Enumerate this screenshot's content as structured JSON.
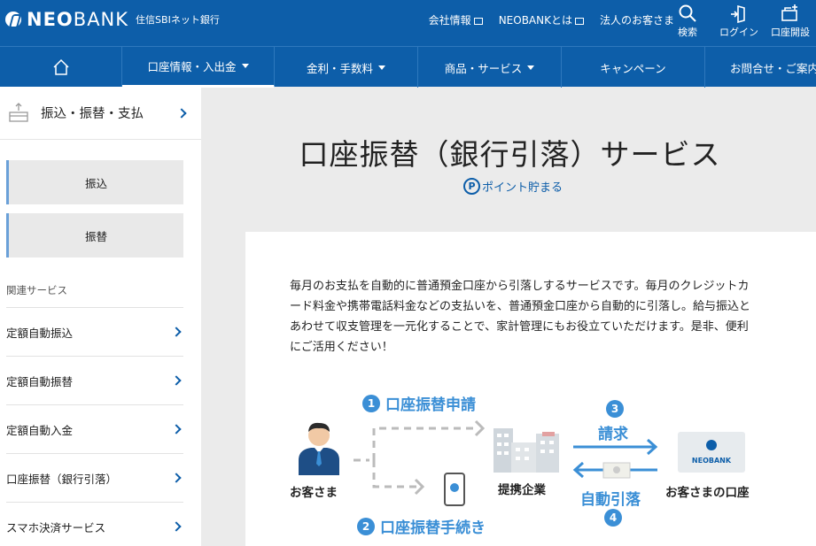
{
  "header": {
    "logo_bold": "NEO",
    "logo_rest": "BANK",
    "logo_sub": "住信SBIネット銀行",
    "links": [
      "会社情報",
      "NEOBANKとは",
      "法人のお客さま"
    ],
    "icons": [
      {
        "label": "検索",
        "icon": "search-icon"
      },
      {
        "label": "ログイン",
        "icon": "login-icon"
      },
      {
        "label": "口座開設",
        "icon": "account-open-icon"
      }
    ]
  },
  "nav": {
    "items": [
      "口座情報・入出金",
      "金利・手数料",
      "商品・サービス",
      "キャンペーン",
      "お問合せ・ご案内"
    ]
  },
  "sidebar": {
    "heading": "振込・振替・支払",
    "buttons": [
      "振込",
      "振替"
    ],
    "section_label": "関連サービス",
    "links": [
      "定額自動振込",
      "定額自動振替",
      "定額自動入金",
      "口座振替（銀行引落）",
      "スマホ決済サービス"
    ]
  },
  "main": {
    "title": "口座振替（銀行引落）サービス",
    "points": "ポイント貯まる",
    "description": "毎月のお支払を自動的に普通預金口座から引落しするサービスです。毎月のクレジットカード料金や携帯電話料金などの支払いを、普通預金口座から自動的に引落し。給与振込とあわせて収支管理を一元化することで、家計管理にもお役立ていただけます。是非、便利にご活用ください！"
  },
  "diagram": {
    "customer": "お客さま",
    "company": "提携企業",
    "account": "お客さまの口座",
    "bank_logo": "NEOBANK",
    "steps": [
      {
        "num": "1",
        "label": "口座振替申請"
      },
      {
        "num": "2",
        "label": "口座振替手続き"
      },
      {
        "num": "3",
        "label": "請求"
      },
      {
        "num": "4",
        "label": "自動引落"
      }
    ]
  },
  "colors": {
    "brand": "#0d5ea9",
    "accent": "#3b8fd6"
  }
}
